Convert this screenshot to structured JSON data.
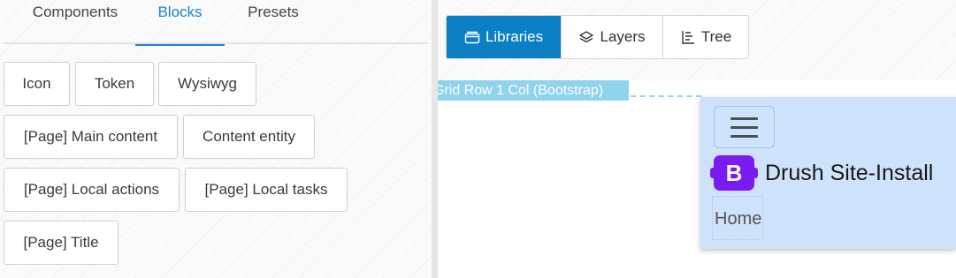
{
  "left_panel": {
    "tabs": [
      {
        "label": "Components",
        "active": false
      },
      {
        "label": "Blocks",
        "active": true
      },
      {
        "label": "Presets",
        "active": false
      }
    ],
    "blocks": [
      {
        "label": "Icon"
      },
      {
        "label": "Token"
      },
      {
        "label": "Wysiwyg"
      },
      {
        "label": "[Page] Main content"
      },
      {
        "label": "Content entity"
      },
      {
        "label": "[Page] Local actions"
      },
      {
        "label": "[Page] Local tasks"
      },
      {
        "label": "[Page] Title"
      }
    ]
  },
  "right_panel": {
    "view_buttons": [
      {
        "label": "Libraries",
        "icon": "folder-icon",
        "active": true
      },
      {
        "label": "Layers",
        "icon": "layers-icon",
        "active": false
      },
      {
        "label": "Tree",
        "icon": "tree-icon",
        "active": false
      }
    ],
    "canvas": {
      "grid_label": "Grid Row 1 Col (Bootstrap)",
      "navbar": {
        "brand_logo_letter": "B",
        "brand_name": "Drush Site-Install",
        "home_link": "Home"
      }
    }
  },
  "colors": {
    "accent": "#0a7fc4",
    "tab_active": "#1a84c7",
    "grid_label_bg": "#8fd3ef",
    "navbar_bg": "#cfe2fb",
    "bootstrap_purple": "#7a1cf0"
  }
}
